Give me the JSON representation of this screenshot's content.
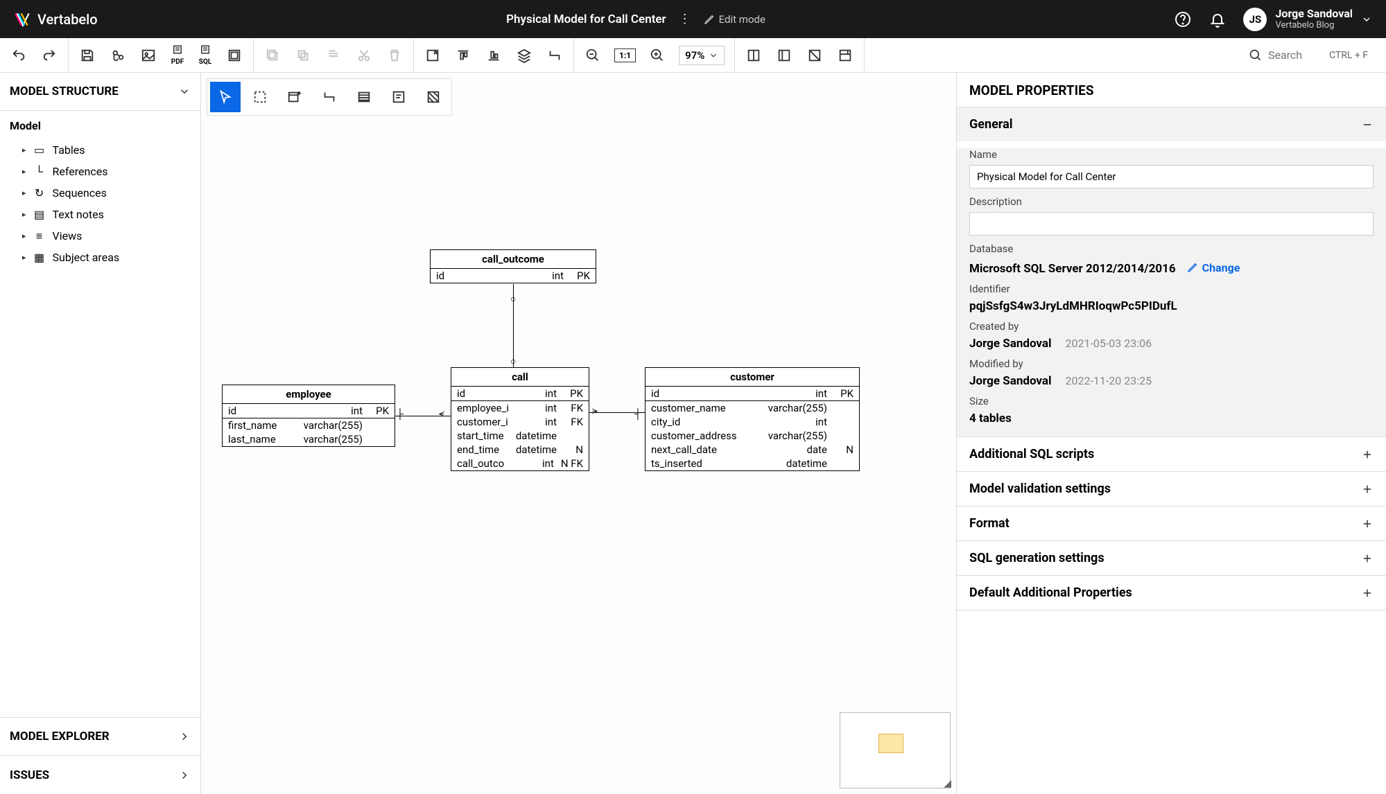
{
  "header": {
    "brand": "Vertabelo",
    "title": "Physical Model for Call Center",
    "edit_mode": "Edit mode",
    "user_initials": "JS",
    "user_name": "Jorge Sandoval",
    "user_sub": "Vertabelo Blog"
  },
  "toolbar": {
    "pdf_label": "PDF",
    "sql_label": "SQL",
    "ratio": "1:1",
    "zoom": "97%",
    "search_placeholder": "Search",
    "search_kbd": "CTRL + F"
  },
  "left": {
    "structure_title": "MODEL STRUCTURE",
    "root": "Model",
    "items": [
      {
        "label": "Tables"
      },
      {
        "label": "References"
      },
      {
        "label": "Sequences"
      },
      {
        "label": "Text notes"
      },
      {
        "label": "Views"
      },
      {
        "label": "Subject areas"
      }
    ],
    "explorer_title": "MODEL EXPLORER",
    "issues_title": "ISSUES"
  },
  "canvas_tables": {
    "call_outcome": {
      "name": "call_outcome",
      "rows": [
        {
          "c": "id",
          "t": "int",
          "k": "PK"
        }
      ]
    },
    "employee": {
      "name": "employee",
      "rows": [
        {
          "c": "id",
          "t": "int",
          "k": "PK"
        },
        {
          "c": "first_name",
          "t": "varchar(255)",
          "k": ""
        },
        {
          "c": "last_name",
          "t": "varchar(255)",
          "k": ""
        }
      ]
    },
    "call": {
      "name": "call",
      "rows": [
        {
          "c": "id",
          "t": "int",
          "k": "PK"
        },
        {
          "c": "employee_i",
          "t": "int",
          "k": "FK"
        },
        {
          "c": "customer_i",
          "t": "int",
          "k": "FK"
        },
        {
          "c": "start_time",
          "t": "datetime",
          "k": ""
        },
        {
          "c": "end_time",
          "t": "datetime",
          "k": "N"
        },
        {
          "c": "call_outco",
          "t": "int",
          "k": "N FK"
        }
      ]
    },
    "customer": {
      "name": "customer",
      "rows": [
        {
          "c": "id",
          "t": "int",
          "k": "PK"
        },
        {
          "c": "customer_name",
          "t": "varchar(255)",
          "k": ""
        },
        {
          "c": "city_id",
          "t": "int",
          "k": ""
        },
        {
          "c": "customer_address",
          "t": "varchar(255)",
          "k": ""
        },
        {
          "c": "next_call_date",
          "t": "date",
          "k": "N"
        },
        {
          "c": "ts_inserted",
          "t": "datetime",
          "k": ""
        }
      ]
    }
  },
  "right": {
    "title": "MODEL PROPERTIES",
    "general": {
      "header": "General",
      "name_label": "Name",
      "name_value": "Physical Model for Call Center",
      "desc_label": "Description",
      "desc_value": "",
      "db_label": "Database",
      "db_value": "Microsoft SQL Server 2012/2014/2016",
      "change": "Change",
      "id_label": "Identifier",
      "id_value": "pqjSsfgS4w3JryLdMHRIoqwPc5PIDufL",
      "created_label": "Created by",
      "created_by": "Jorge Sandoval",
      "created_at": "2021-05-03 23:06",
      "modified_label": "Modified by",
      "modified_by": "Jorge Sandoval",
      "modified_at": "2022-11-20 23:25",
      "size_label": "Size",
      "size_value": "4 tables"
    },
    "sections": [
      "Additional SQL scripts",
      "Model validation settings",
      "Format",
      "SQL generation settings",
      "Default Additional Properties"
    ]
  }
}
